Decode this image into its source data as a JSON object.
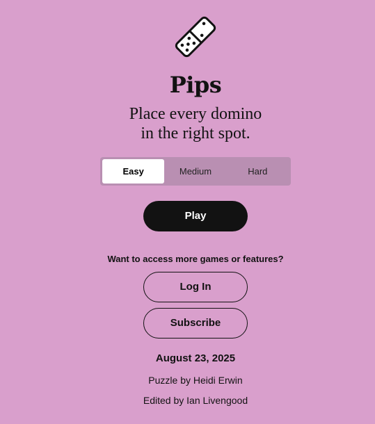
{
  "app": {
    "logo_icon": "domino-pips-icon",
    "title": "Pips",
    "subtitle_line1": "Place every domino",
    "subtitle_line2": "in the right spot."
  },
  "difficulty": {
    "options": [
      "Easy",
      "Medium",
      "Hard"
    ],
    "selected": "Easy"
  },
  "play_label": "Play",
  "account": {
    "prompt": "Want to access more games or features?",
    "login_label": "Log In",
    "subscribe_label": "Subscribe"
  },
  "puzzle": {
    "date": "August 23, 2025",
    "author": "Puzzle by Heidi Erwin",
    "editor": "Edited by Ian Livengood"
  },
  "colors": {
    "background": "#d99fcc",
    "button_dark": "#121212",
    "segment_track": "#b98fb2"
  }
}
